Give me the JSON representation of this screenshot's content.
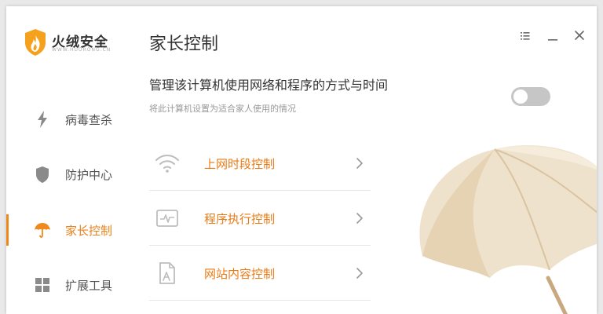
{
  "app": {
    "name": "火绒安全",
    "url": "WWW.HUORONG.CN"
  },
  "sidebar": {
    "items": [
      {
        "label": "病毒查杀",
        "icon": "lightning-icon"
      },
      {
        "label": "防护中心",
        "icon": "shield-icon"
      },
      {
        "label": "家长控制",
        "icon": "umbrella-icon",
        "active": true
      },
      {
        "label": "扩展工具",
        "icon": "grid-icon"
      }
    ]
  },
  "page": {
    "title": "家长控制",
    "headline": "管理该计算机使用网络和程序的方式与时间",
    "subtitle": "将此计算机设置为适合家人使用的情况",
    "toggle_on": false
  },
  "features": [
    {
      "label": "上网时段控制",
      "icon": "wifi-icon"
    },
    {
      "label": "程序执行控制",
      "icon": "program-monitor-icon"
    },
    {
      "label": "网站内容控制",
      "icon": "web-document-icon"
    }
  ],
  "colors": {
    "accent": "#f0891a",
    "accent_text": "#e87a14",
    "toggle_off": "#c6c6c6"
  }
}
